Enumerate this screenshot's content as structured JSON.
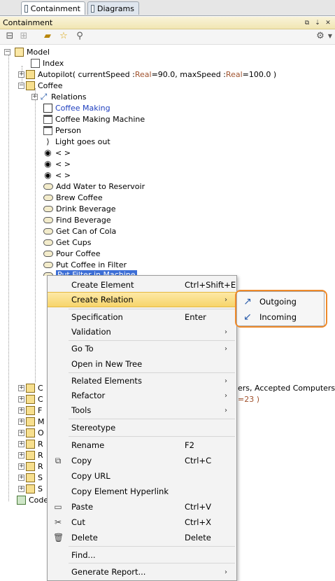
{
  "tabs": [
    {
      "label": "Containment",
      "active": true
    },
    {
      "label": "Diagrams",
      "active": false
    }
  ],
  "panel": {
    "title": "Containment"
  },
  "tree": {
    "model": "Model",
    "index": "Index",
    "autopilot": {
      "name": "Autopilot",
      "params": "( currentSpeed : ",
      "type1": "Real",
      "val1": "=90.0, maxSpeed : ",
      "type2": "Real",
      "val2": "=100.0 )"
    },
    "coffee": "Coffee",
    "relations": "Relations",
    "coffee_making": "Coffee Making",
    "coffee_machine": "Coffee Making Machine",
    "person": "Person",
    "light": "Light goes out",
    "pseudo": "< >",
    "usecases": [
      "Add Water to Reservoir",
      "Brew Coffee",
      "Drink Beverage",
      "Find Beverage",
      "Get Can of Cola",
      "Get Cups",
      "Pour Coffee",
      "Put Coffee in Filter"
    ],
    "selected": "Put Filter in Machine",
    "partial_right1": "ers, Accepted Computers )",
    "partial_right2": "=23 )",
    "cut_letters": [
      "C",
      "C",
      "F",
      "M",
      "O",
      "R",
      "R",
      "R",
      "S",
      "S"
    ],
    "code": "Code"
  },
  "context_menu": {
    "create_element": "Create Element",
    "create_element_sc": "Ctrl+Shift+E",
    "create_relation": "Create Relation",
    "specification": "Specification",
    "specification_sc": "Enter",
    "validation": "Validation",
    "go_to": "Go To",
    "open_new_tree": "Open in New Tree",
    "related": "Related Elements",
    "refactor": "Refactor",
    "tools": "Tools",
    "stereotype": "Stereotype",
    "rename": "Rename",
    "rename_sc": "F2",
    "copy": "Copy",
    "copy_sc": "Ctrl+C",
    "copy_url": "Copy URL",
    "copy_link": "Copy Element Hyperlink",
    "paste": "Paste",
    "paste_sc": "Ctrl+V",
    "cut": "Cut",
    "cut_sc": "Ctrl+X",
    "delete": "Delete",
    "delete_sc": "Delete",
    "find": "Find...",
    "report": "Generate Report..."
  },
  "submenu": {
    "outgoing": "Outgoing",
    "incoming": "Incoming"
  },
  "colors": {
    "highlight": "#f7d46a",
    "selection": "#3d6fd6",
    "outline": "#ef8a2a",
    "link_blue": "#1f3fbf",
    "type_brown": "#a0522d"
  }
}
